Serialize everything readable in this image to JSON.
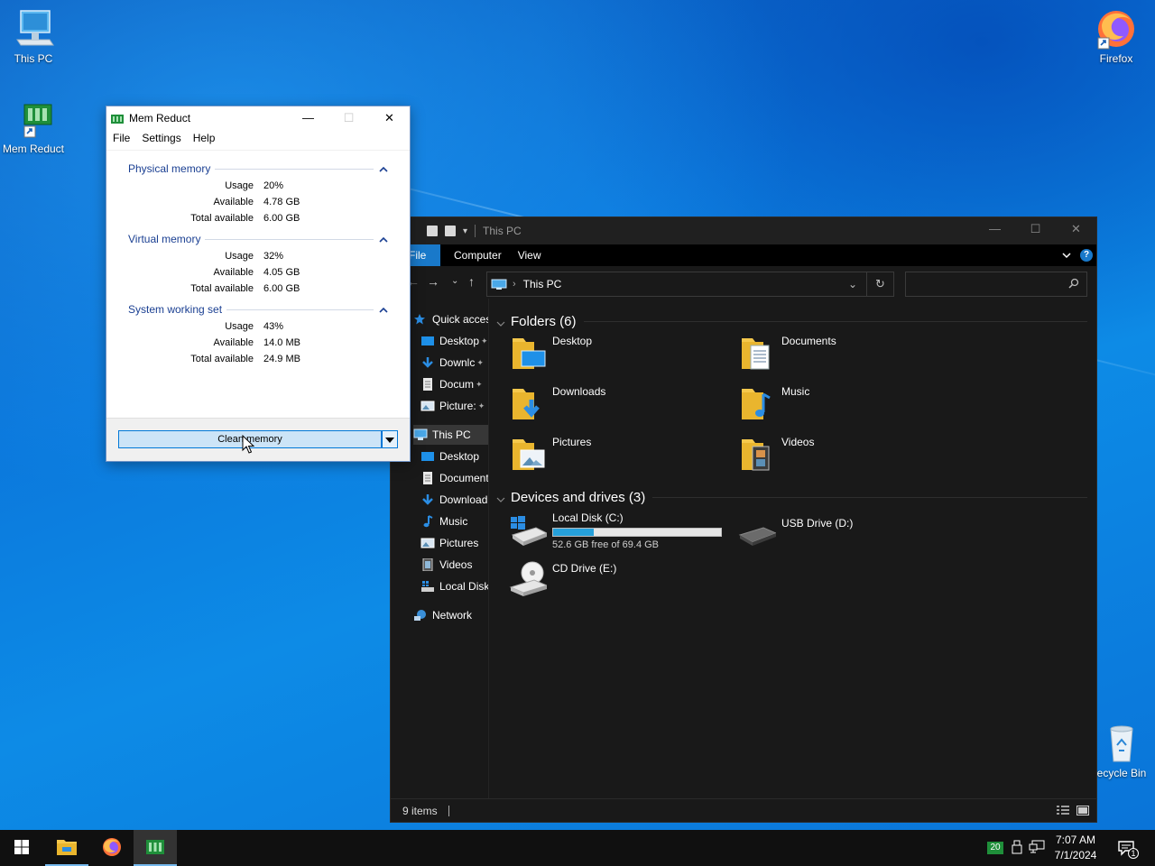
{
  "desktop": {
    "icons": [
      {
        "label": "This PC"
      },
      {
        "label": "Mem Reduct"
      },
      {
        "label": "Firefox"
      },
      {
        "label": "ecycle Bin"
      }
    ]
  },
  "memreduct": {
    "title": "Mem Reduct",
    "menu": [
      "File",
      "Settings",
      "Help"
    ],
    "groups": [
      {
        "title": "Physical memory",
        "rows": [
          {
            "k": "Usage",
            "v": "20%"
          },
          {
            "k": "Available",
            "v": "4.78 GB"
          },
          {
            "k": "Total available",
            "v": "6.00 GB"
          }
        ]
      },
      {
        "title": "Virtual memory",
        "rows": [
          {
            "k": "Usage",
            "v": "32%"
          },
          {
            "k": "Available",
            "v": "4.05 GB"
          },
          {
            "k": "Total available",
            "v": "6.00 GB"
          }
        ]
      },
      {
        "title": "System working set",
        "rows": [
          {
            "k": "Usage",
            "v": "43%"
          },
          {
            "k": "Available",
            "v": "14.0 MB"
          },
          {
            "k": "Total available",
            "v": "24.9 MB"
          }
        ]
      }
    ],
    "clean_button": "Clean memory"
  },
  "explorer": {
    "title": "This PC",
    "ribbon_tabs": {
      "file": "File",
      "computer": "Computer",
      "view": "View"
    },
    "help": "?",
    "address": "This PC",
    "nav": [
      {
        "label": "Quick acces"
      },
      {
        "label": "Desktop"
      },
      {
        "label": "Downlc"
      },
      {
        "label": "Docum"
      },
      {
        "label": "Picture:"
      },
      {
        "label": "This PC"
      },
      {
        "label": "Desktop"
      },
      {
        "label": "Document"
      },
      {
        "label": "Download"
      },
      {
        "label": "Music"
      },
      {
        "label": "Pictures"
      },
      {
        "label": "Videos"
      },
      {
        "label": "Local Disk"
      },
      {
        "label": "Network"
      }
    ],
    "folders_header": "Folders (6)",
    "folders": [
      {
        "label": "Desktop"
      },
      {
        "label": "Documents"
      },
      {
        "label": "Downloads"
      },
      {
        "label": "Music"
      },
      {
        "label": "Pictures"
      },
      {
        "label": "Videos"
      }
    ],
    "drives_header": "Devices and drives (3)",
    "drives": [
      {
        "label": "Local Disk (C:)",
        "free": "52.6 GB free of 69.4 GB",
        "used_fraction": 0.24
      },
      {
        "label": "USB Drive (D:)"
      },
      {
        "label": "CD Drive (E:)"
      }
    ],
    "status": "9 items"
  },
  "taskbar": {
    "tray_badge": "20",
    "time": "7:07 AM",
    "date": "7/1/2024",
    "notification_count": "1"
  },
  "colors": {
    "accent": "#0078d7",
    "explorer_bg": "#191919",
    "drive_fill": "#26a0da",
    "folder_yellow": "#f5c84c"
  }
}
